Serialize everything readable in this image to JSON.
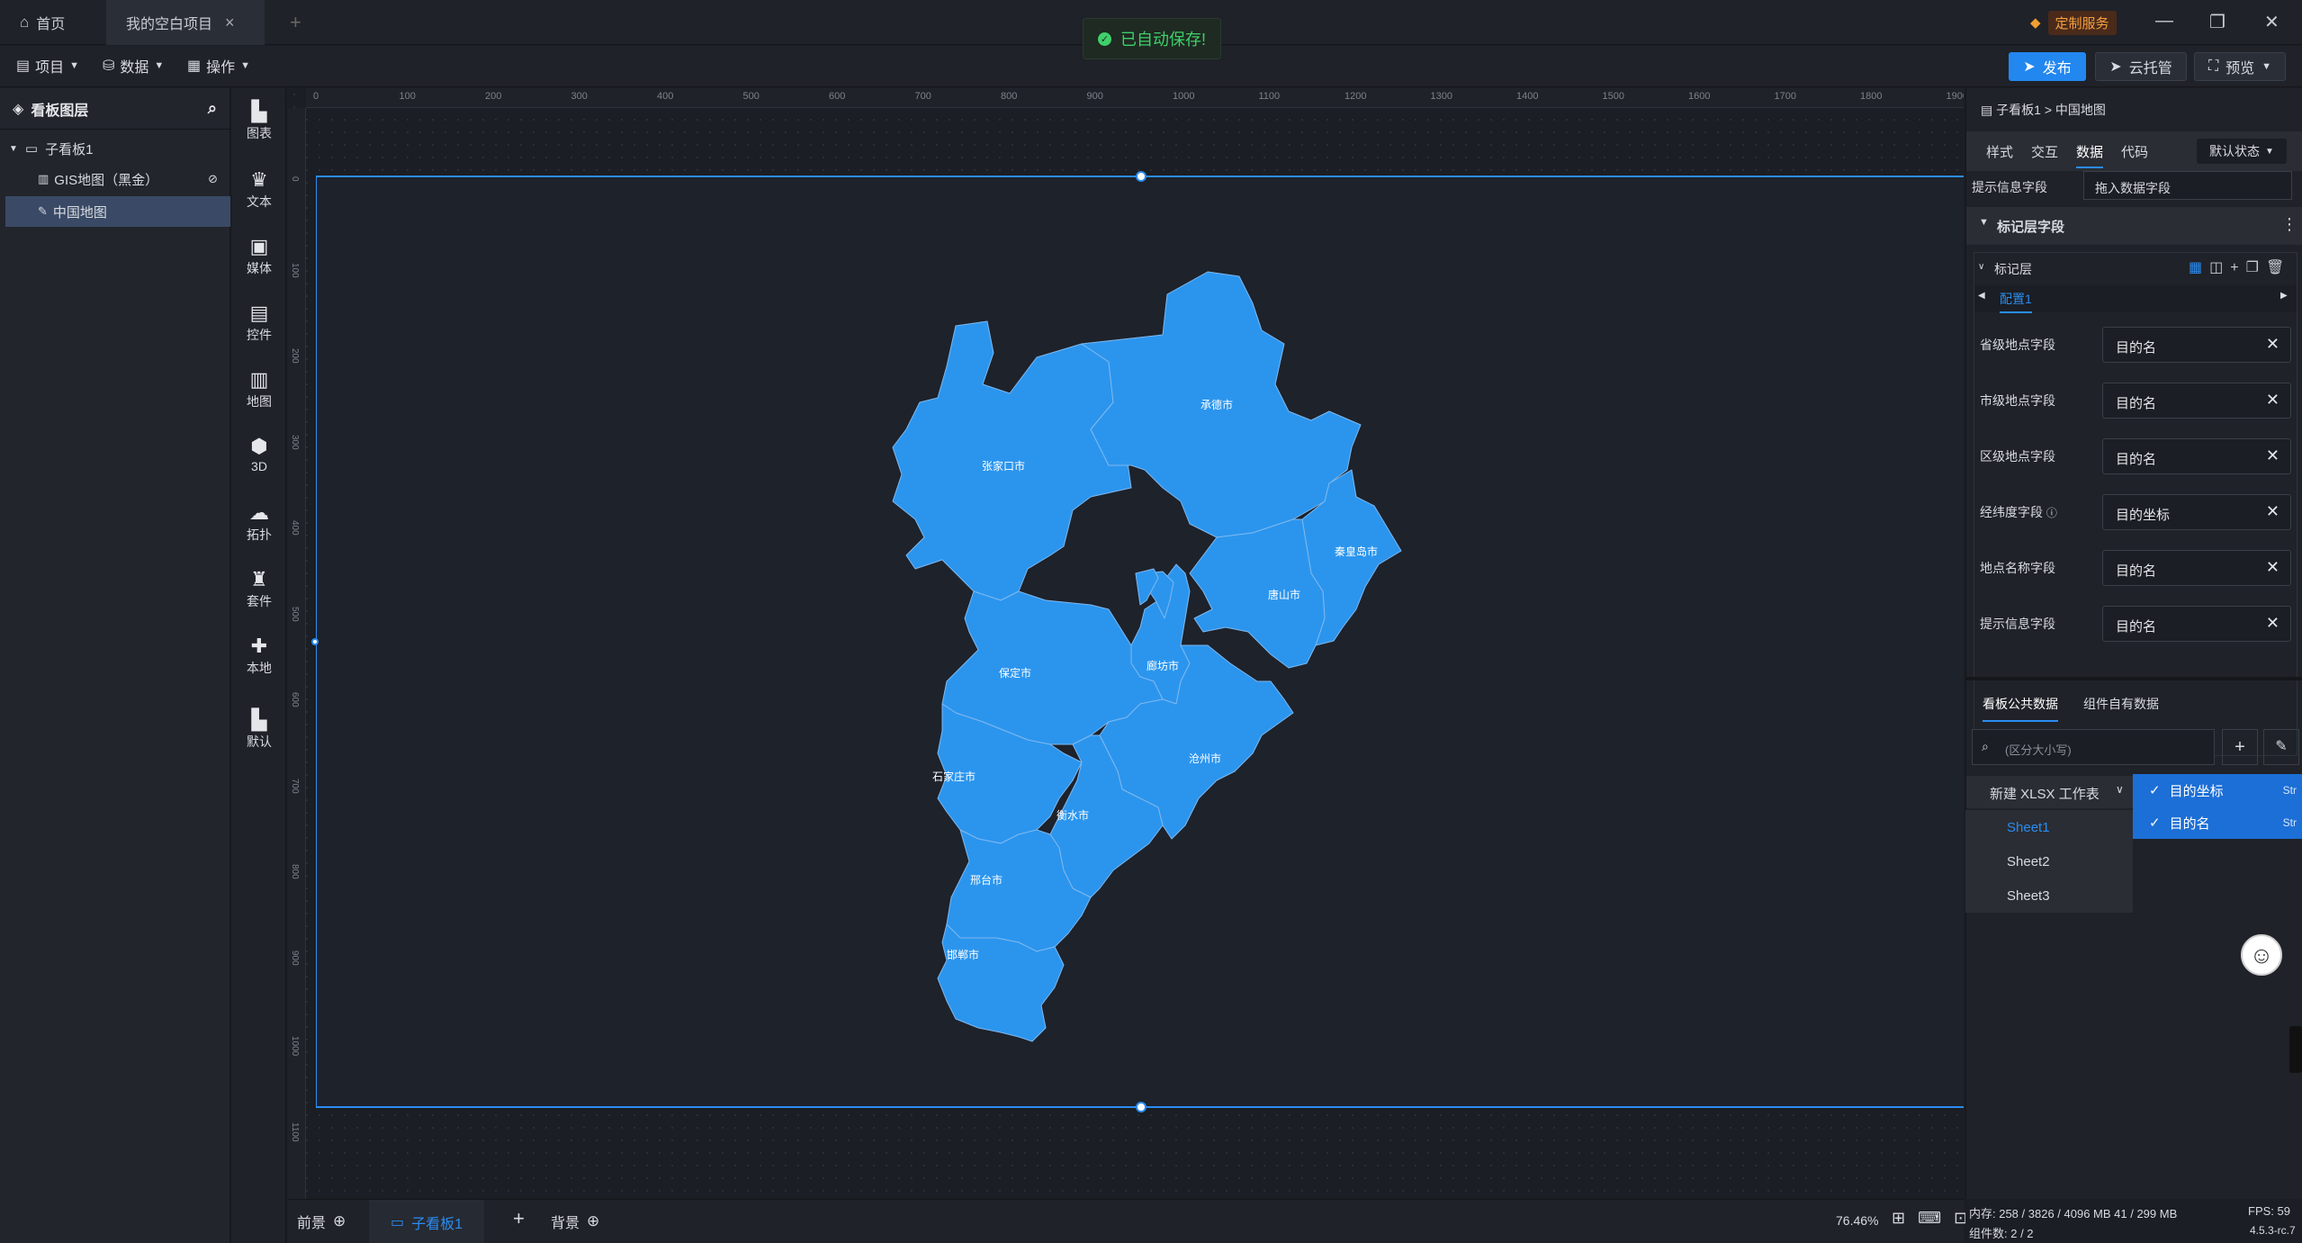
{
  "tabs": {
    "home": "首页",
    "project": "我的空白项目"
  },
  "toast": "已自动保存!",
  "custom_service": "定制服务",
  "toolbar": {
    "project": "项目",
    "data": "数据",
    "ops": "操作",
    "publish": "发布",
    "cloud": "云托管",
    "preview": "预览"
  },
  "layers": {
    "title": "看板图层",
    "items": [
      {
        "label": "子看板1"
      },
      {
        "label": "GIS地图（黑金）"
      },
      {
        "label": "中国地图"
      }
    ]
  },
  "tools": [
    "图表",
    "文本",
    "媒体",
    "控件",
    "地图",
    "3D",
    "拓扑",
    "套件",
    "本地",
    "默认"
  ],
  "ruler_ticks": [
    "0",
    "100",
    "200",
    "300",
    "400",
    "500",
    "600",
    "700",
    "800",
    "900",
    "1000",
    "1100",
    "1200",
    "1300",
    "1400",
    "1500",
    "1600",
    "1700",
    "1800",
    "1900"
  ],
  "ruler_left_ticks": [
    "0",
    "100",
    "200",
    "300",
    "400",
    "500",
    "600",
    "700",
    "800",
    "900",
    "1000",
    "1100"
  ],
  "map_labels": [
    "张家口市",
    "承德市",
    "秦皇岛市",
    "唐山市",
    "廊坊市",
    "保定市",
    "沧州市",
    "石家庄市",
    "衡水市",
    "邢台市",
    "邯郸市"
  ],
  "bottom": {
    "foreground": "前景",
    "board": "子看板1",
    "background": "背景",
    "zoom": "76.46%"
  },
  "rpanel": {
    "breadcrumb_parent": "子看板1",
    "breadcrumb_sep": ">",
    "breadcrumb_current": "中国地图",
    "tabs": [
      "样式",
      "交互",
      "数据",
      "代码"
    ],
    "state": "默认状态",
    "tooltip_label": "提示信息字段",
    "tooltip_placeholder": "拖入数据字段",
    "section_title": "标记层字段",
    "layer_title": "标记层",
    "config_tab": "配置1",
    "fields": [
      {
        "label": "省级地点字段",
        "value": "目的名"
      },
      {
        "label": "市级地点字段",
        "value": "目的名"
      },
      {
        "label": "区级地点字段",
        "value": "目的名"
      },
      {
        "label": "经纬度字段",
        "value": "目的坐标"
      },
      {
        "label": "地点名称字段",
        "value": "目的名"
      },
      {
        "label": "提示信息字段",
        "value": "目的名"
      }
    ],
    "data_tabs": [
      "看板公共数据",
      "组件自有数据"
    ],
    "search_placeholder": "(区分大小写)",
    "workbook": "新建 XLSX 工作表",
    "sheets": [
      "Sheet1",
      "Sheet2",
      "Sheet3"
    ],
    "columns": [
      {
        "name": "目的坐标",
        "type": "Str"
      },
      {
        "name": "目的名",
        "type": "Str"
      }
    ]
  },
  "status": {
    "memory": "内存: 258 / 3826 / 4096 MB 41 / 299 MB",
    "fps": "FPS: 59",
    "components": "组件数: 2 / 2",
    "version": "4.5.3-rc.7"
  },
  "colors": {
    "accent": "#2387f0",
    "map_fill": "#2b95ee",
    "toast": "#3fcf6a"
  }
}
